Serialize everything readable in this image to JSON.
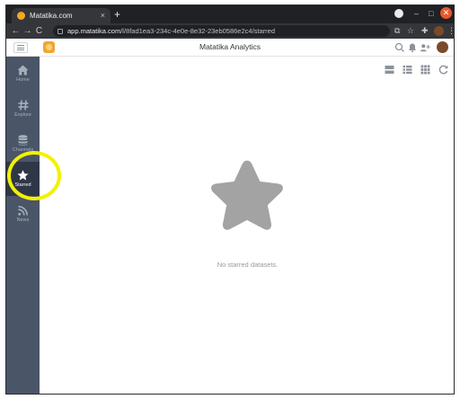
{
  "browser": {
    "tab_title": "Matatika.com",
    "tab_close": "×",
    "new_tab": "+",
    "window_controls": {
      "minimize": "–",
      "maximize": "□",
      "close": "✕"
    },
    "nav": {
      "back": "←",
      "forward": "→",
      "reload": "C"
    },
    "url_host": "app.matatika.com",
    "url_path": "/l/8fad1ea3-234c-4e0e-8e32-23eb0586e2c4/starred",
    "toolbar_icons": {
      "share": "⧉",
      "star": "☆",
      "extensions": "✚",
      "menu": "⋮"
    }
  },
  "app": {
    "title": "Matatika Analytics"
  },
  "sidebar": {
    "items": [
      {
        "label": "Home",
        "icon": "home-icon",
        "active": false
      },
      {
        "label": "Explore",
        "icon": "hash-icon",
        "active": false
      },
      {
        "label": "Channels",
        "icon": "database-icon",
        "active": false
      },
      {
        "label": "Starred",
        "icon": "star-icon",
        "active": true
      },
      {
        "label": "News",
        "icon": "rss-icon",
        "active": false
      }
    ]
  },
  "main": {
    "empty_message": "No starred datasets.",
    "view_tools": [
      "list-view-icon",
      "table-view-icon",
      "grid-view-icon",
      "refresh-icon"
    ]
  },
  "colors": {
    "sidebar_bg": "#4a5568",
    "sidebar_active_bg": "#2f3746",
    "highlight": "#f2f200",
    "empty_star": "#a3a3a3",
    "brand": "#f0a630"
  }
}
